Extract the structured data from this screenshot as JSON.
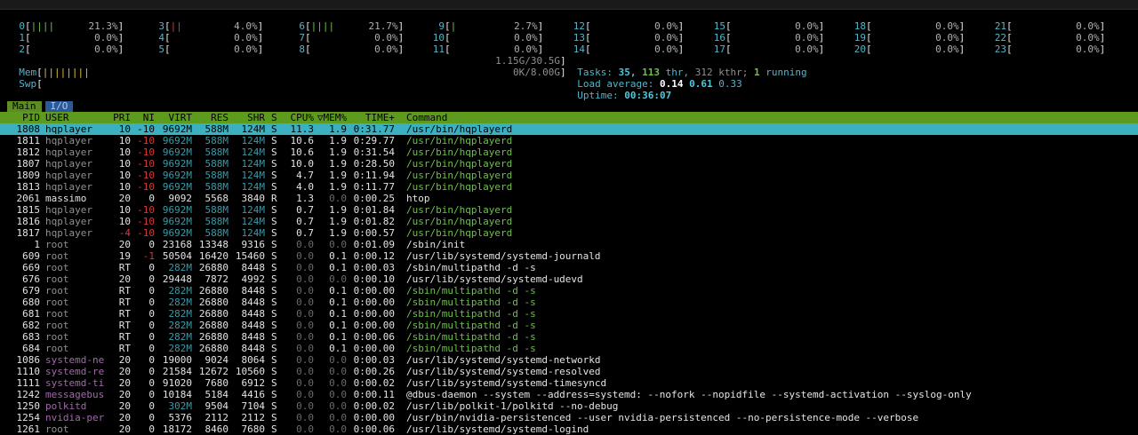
{
  "cpus": [
    {
      "id": "0",
      "bars": "||||",
      "pct": "21.3%"
    },
    {
      "id": "1",
      "bars": "",
      "pct": "0.0%"
    },
    {
      "id": "2",
      "bars": "",
      "pct": "0.0%"
    },
    {
      "id": "3",
      "bars": "||",
      "pct": "4.0%",
      "red": true
    },
    {
      "id": "4",
      "bars": "",
      "pct": "0.0%"
    },
    {
      "id": "5",
      "bars": "",
      "pct": "0.0%"
    },
    {
      "id": "6",
      "bars": "||||",
      "pct": "21.7%"
    },
    {
      "id": "7",
      "bars": "",
      "pct": "0.0%"
    },
    {
      "id": "8",
      "bars": "",
      "pct": "0.0%"
    },
    {
      "id": "9",
      "bars": "|",
      "pct": "2.7%"
    },
    {
      "id": "10",
      "bars": "",
      "pct": "0.0%"
    },
    {
      "id": "11",
      "bars": "",
      "pct": "0.0%"
    },
    {
      "id": "12",
      "bars": "",
      "pct": "0.0%"
    },
    {
      "id": "13",
      "bars": "",
      "pct": "0.0%"
    },
    {
      "id": "14",
      "bars": "",
      "pct": "0.0%"
    },
    {
      "id": "15",
      "bars": "",
      "pct": "0.0%"
    },
    {
      "id": "16",
      "bars": "",
      "pct": "0.0%"
    },
    {
      "id": "17",
      "bars": "",
      "pct": "0.0%"
    },
    {
      "id": "18",
      "bars": "",
      "pct": "0.0%"
    },
    {
      "id": "19",
      "bars": "",
      "pct": "0.0%"
    },
    {
      "id": "20",
      "bars": "",
      "pct": "0.0%"
    },
    {
      "id": "21",
      "bars": "",
      "pct": "0.0%"
    },
    {
      "id": "22",
      "bars": "",
      "pct": "0.0%"
    },
    {
      "id": "23",
      "bars": "",
      "pct": "0.0%"
    }
  ],
  "mem": {
    "label": "Mem",
    "bars": "||||||||",
    "value": "1.15G/30.5G"
  },
  "swp": {
    "label": "Swp",
    "value": "0K/8.00G"
  },
  "tasks": {
    "label": "Tasks:",
    "count": "35,",
    "thr": "113",
    "thr_label": "thr,",
    "kthr": "312 kthr;",
    "running": "1",
    "running_label": "running"
  },
  "load": {
    "label": "Load average:",
    "one": "0.14",
    "five": "0.61",
    "fifteen": "0.33"
  },
  "uptime": {
    "label": "Uptime:",
    "value": "00:36:07"
  },
  "tabs": [
    "Main",
    "I/O"
  ],
  "columns": [
    "PID",
    "USER",
    "PRI",
    "NI",
    "VIRT",
    "RES",
    "SHR",
    "S",
    "CPU%",
    "▽MEM%",
    "TIME+",
    "Command"
  ],
  "processes": [
    {
      "pid": "1808",
      "user": "hqplayer",
      "pri": "10",
      "ni": "-10",
      "virt": "9692M",
      "res": "588M",
      "shr": "124M",
      "s": "S",
      "cpu": "11.3",
      "mem": "1.9",
      "time": "0:31.77",
      "cmd": "/usr/bin/hqplayerd",
      "sel": true
    },
    {
      "pid": "1811",
      "user": "hqplayer",
      "pri": "10",
      "ni": "-10",
      "virt": "9692M",
      "res": "588M",
      "shr": "124M",
      "s": "S",
      "cpu": "10.6",
      "mem": "1.9",
      "time": "0:29.77",
      "cmd": "/usr/bin/hqplayerd"
    },
    {
      "pid": "1812",
      "user": "hqplayer",
      "pri": "10",
      "ni": "-10",
      "virt": "9692M",
      "res": "588M",
      "shr": "124M",
      "s": "S",
      "cpu": "10.6",
      "mem": "1.9",
      "time": "0:31.54",
      "cmd": "/usr/bin/hqplayerd"
    },
    {
      "pid": "1807",
      "user": "hqplayer",
      "pri": "10",
      "ni": "-10",
      "virt": "9692M",
      "res": "588M",
      "shr": "124M",
      "s": "S",
      "cpu": "10.0",
      "mem": "1.9",
      "time": "0:28.50",
      "cmd": "/usr/bin/hqplayerd"
    },
    {
      "pid": "1809",
      "user": "hqplayer",
      "pri": "10",
      "ni": "-10",
      "virt": "9692M",
      "res": "588M",
      "shr": "124M",
      "s": "S",
      "cpu": "4.7",
      "mem": "1.9",
      "time": "0:11.94",
      "cmd": "/usr/bin/hqplayerd"
    },
    {
      "pid": "1813",
      "user": "hqplayer",
      "pri": "10",
      "ni": "-10",
      "virt": "9692M",
      "res": "588M",
      "shr": "124M",
      "s": "S",
      "cpu": "4.0",
      "mem": "1.9",
      "time": "0:11.77",
      "cmd": "/usr/bin/hqplayerd"
    },
    {
      "pid": "2061",
      "user": "massimo",
      "pri": "20",
      "ni": "0",
      "virt": "9092",
      "res": "5568",
      "shr": "3840",
      "s": "R",
      "cpu": "1.3",
      "mem": "0.0",
      "time": "0:00.25",
      "cmd": "htop"
    },
    {
      "pid": "1815",
      "user": "hqplayer",
      "pri": "10",
      "ni": "-10",
      "virt": "9692M",
      "res": "588M",
      "shr": "124M",
      "s": "S",
      "cpu": "0.7",
      "mem": "1.9",
      "time": "0:01.84",
      "cmd": "/usr/bin/hqplayerd"
    },
    {
      "pid": "1816",
      "user": "hqplayer",
      "pri": "10",
      "ni": "-10",
      "virt": "9692M",
      "res": "588M",
      "shr": "124M",
      "s": "S",
      "cpu": "0.7",
      "mem": "1.9",
      "time": "0:01.82",
      "cmd": "/usr/bin/hqplayerd"
    },
    {
      "pid": "1817",
      "user": "hqplayer",
      "pri": "-4",
      "ni": "-10",
      "virt": "9692M",
      "res": "588M",
      "shr": "124M",
      "s": "S",
      "cpu": "0.7",
      "mem": "1.9",
      "time": "0:00.57",
      "cmd": "/usr/bin/hqplayerd"
    },
    {
      "pid": "1",
      "user": "root",
      "pri": "20",
      "ni": "0",
      "virt": "23168",
      "res": "13348",
      "shr": "9316",
      "s": "S",
      "cpu": "0.0",
      "mem": "0.0",
      "time": "0:01.09",
      "cmd": "/sbin/init"
    },
    {
      "pid": "609",
      "user": "root",
      "pri": "19",
      "ni": "-1",
      "virt": "50504",
      "res": "16420",
      "shr": "15460",
      "s": "S",
      "cpu": "0.0",
      "mem": "0.1",
      "time": "0:00.12",
      "cmd": "/usr/lib/systemd/systemd-journald"
    },
    {
      "pid": "669",
      "user": "root",
      "pri": "RT",
      "ni": "0",
      "virt": "282M",
      "res": "26880",
      "shr": "8448",
      "s": "S",
      "cpu": "0.0",
      "mem": "0.1",
      "time": "0:00.03",
      "cmd": "/sbin/multipathd -d -s"
    },
    {
      "pid": "676",
      "user": "root",
      "pri": "20",
      "ni": "0",
      "virt": "29448",
      "res": "7872",
      "shr": "4992",
      "s": "S",
      "cpu": "0.0",
      "mem": "0.0",
      "time": "0:00.10",
      "cmd": "/usr/lib/systemd/systemd-udevd"
    },
    {
      "pid": "679",
      "user": "root",
      "pri": "RT",
      "ni": "0",
      "virt": "282M",
      "res": "26880",
      "shr": "8448",
      "s": "S",
      "cpu": "0.0",
      "mem": "0.1",
      "time": "0:00.00",
      "cmd": "/sbin/multipathd -d -s",
      "thread": true
    },
    {
      "pid": "680",
      "user": "root",
      "pri": "RT",
      "ni": "0",
      "virt": "282M",
      "res": "26880",
      "shr": "8448",
      "s": "S",
      "cpu": "0.0",
      "mem": "0.1",
      "time": "0:00.00",
      "cmd": "/sbin/multipathd -d -s",
      "thread": true
    },
    {
      "pid": "681",
      "user": "root",
      "pri": "RT",
      "ni": "0",
      "virt": "282M",
      "res": "26880",
      "shr": "8448",
      "s": "S",
      "cpu": "0.0",
      "mem": "0.1",
      "time": "0:00.00",
      "cmd": "/sbin/multipathd -d -s",
      "thread": true
    },
    {
      "pid": "682",
      "user": "root",
      "pri": "RT",
      "ni": "0",
      "virt": "282M",
      "res": "26880",
      "shr": "8448",
      "s": "S",
      "cpu": "0.0",
      "mem": "0.1",
      "time": "0:00.00",
      "cmd": "/sbin/multipathd -d -s",
      "thread": true
    },
    {
      "pid": "683",
      "user": "root",
      "pri": "RT",
      "ni": "0",
      "virt": "282M",
      "res": "26880",
      "shr": "8448",
      "s": "S",
      "cpu": "0.0",
      "mem": "0.1",
      "time": "0:00.06",
      "cmd": "/sbin/multipathd -d -s",
      "thread": true
    },
    {
      "pid": "684",
      "user": "root",
      "pri": "RT",
      "ni": "0",
      "virt": "282M",
      "res": "26880",
      "shr": "8448",
      "s": "S",
      "cpu": "0.0",
      "mem": "0.1",
      "time": "0:00.00",
      "cmd": "/sbin/multipathd -d -s",
      "thread": true
    },
    {
      "pid": "1086",
      "user": "systemd-ne",
      "pri": "20",
      "ni": "0",
      "virt": "19000",
      "res": "9024",
      "shr": "8064",
      "s": "S",
      "cpu": "0.0",
      "mem": "0.0",
      "time": "0:00.03",
      "cmd": "/usr/lib/systemd/systemd-networkd"
    },
    {
      "pid": "1110",
      "user": "systemd-re",
      "pri": "20",
      "ni": "0",
      "virt": "21584",
      "res": "12672",
      "shr": "10560",
      "s": "S",
      "cpu": "0.0",
      "mem": "0.0",
      "time": "0:00.26",
      "cmd": "/usr/lib/systemd/systemd-resolved"
    },
    {
      "pid": "1111",
      "user": "systemd-ti",
      "pri": "20",
      "ni": "0",
      "virt": "91020",
      "res": "7680",
      "shr": "6912",
      "s": "S",
      "cpu": "0.0",
      "mem": "0.0",
      "time": "0:00.02",
      "cmd": "/usr/lib/systemd/systemd-timesyncd"
    },
    {
      "pid": "1242",
      "user": "messagebus",
      "pri": "20",
      "ni": "0",
      "virt": "10184",
      "res": "5184",
      "shr": "4416",
      "s": "S",
      "cpu": "0.0",
      "mem": "0.0",
      "time": "0:00.11",
      "cmd": "@dbus-daemon --system --address=systemd: --nofork --nopidfile --systemd-activation --syslog-only"
    },
    {
      "pid": "1250",
      "user": "polkitd",
      "pri": "20",
      "ni": "0",
      "virt": "302M",
      "res": "9504",
      "shr": "7104",
      "s": "S",
      "cpu": "0.0",
      "mem": "0.0",
      "time": "0:00.02",
      "cmd": "/usr/lib/polkit-1/polkitd --no-debug"
    },
    {
      "pid": "1254",
      "user": "nvidia-per",
      "pri": "20",
      "ni": "0",
      "virt": "5376",
      "res": "2112",
      "shr": "2112",
      "s": "S",
      "cpu": "0.0",
      "mem": "0.0",
      "time": "0:00.00",
      "cmd": "/usr/bin/nvidia-persistenced --user nvidia-persistenced --no-persistence-mode --verbose"
    },
    {
      "pid": "1261",
      "user": "root",
      "pri": "20",
      "ni": "0",
      "virt": "18172",
      "res": "8460",
      "shr": "7680",
      "s": "S",
      "cpu": "0.0",
      "mem": "0.0",
      "time": "0:00.06",
      "cmd": "/usr/lib/systemd/systemd-logind"
    }
  ],
  "colors": {
    "header_bg": "#5d9b1e",
    "selected_bg": "#3ab0c0",
    "cpu_bar": "#6fbf4e",
    "cpu_bar_kernel": "#d13b3b",
    "mem_bar": "#d8c13a",
    "accent": "#4ec9d9",
    "tab_active": "#5d8c24",
    "tab_inactive": "#2b5a9a"
  }
}
